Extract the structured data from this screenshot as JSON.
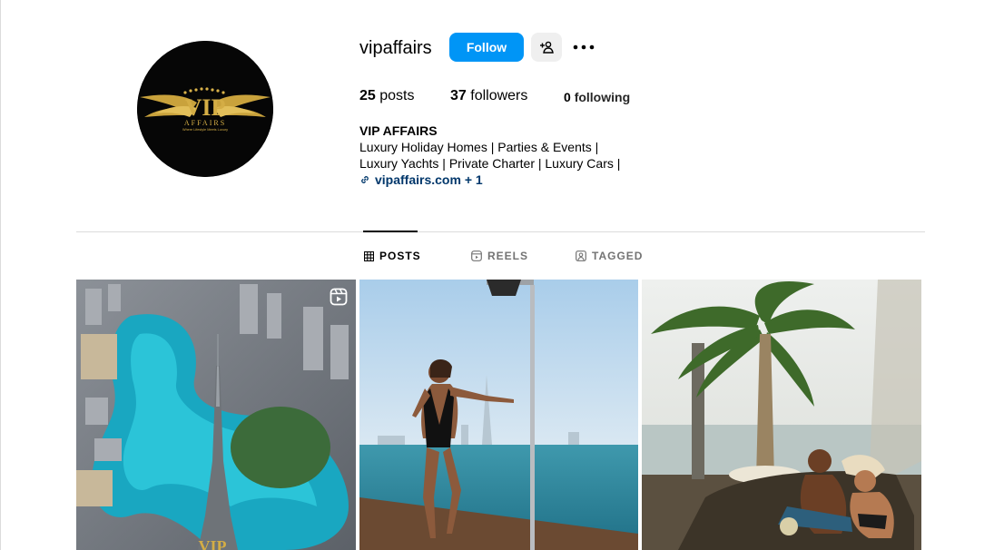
{
  "profile": {
    "username": "vipaffairs",
    "follow_label": "Follow",
    "avatar_logo": "VIP AFFAIRS - Where Lifestyle Meets Luxury"
  },
  "stats": {
    "posts_count": "25",
    "posts_label": "posts",
    "followers_count": "37",
    "followers_label": "followers",
    "following_count": "0",
    "following_label": "following"
  },
  "bio": {
    "name": "VIP AFFAIRS",
    "line1": "Luxury Holiday Homes | Parties & Events |",
    "line2": "Luxury Yachts | Private Charter | Luxury Cars |",
    "link": "vipaffairs.com + 1"
  },
  "tabs": [
    {
      "label": "POSTS",
      "icon": "grid-icon",
      "active": true
    },
    {
      "label": "REELS",
      "icon": "reels-icon",
      "active": false
    },
    {
      "label": "TAGGED",
      "icon": "tagged-icon",
      "active": false
    }
  ],
  "posts": [
    {
      "subject": "Aerial view of Burj Khalifa and Dubai fountain",
      "icon": "reel-icon"
    },
    {
      "subject": "Woman posing by outdoor shower on yacht with Burj Al Arab"
    },
    {
      "subject": "Couple lounging by infinity pool under palm tree"
    }
  ],
  "colors": {
    "follow_button": "#0095f6",
    "link": "#00376b",
    "muted": "#737373",
    "divider": "#dbdbdb"
  }
}
